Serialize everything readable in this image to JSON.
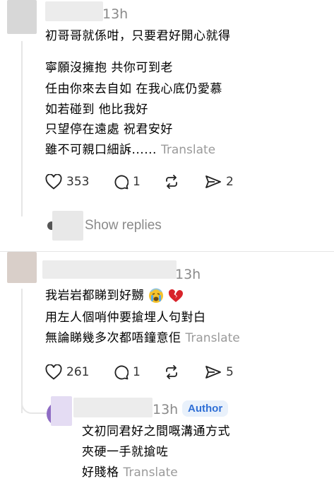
{
  "comment1": {
    "timestamp": "13h",
    "lines": [
      "初哥哥就係咁，只要君好開心就得",
      "寧願沒擁抱 共你可到老",
      "任由你來去自如 在我心底仍愛慕",
      "如若碰到 他比我好",
      "只望停在遠處 祝君安好",
      "雖不可親口細訴......"
    ],
    "translate_label": "Translate",
    "likes": "353",
    "replies": "1",
    "shares": "2",
    "show_replies_label": "Show replies"
  },
  "comment2": {
    "timestamp": "13h",
    "lines": [
      "我岩岩都睇到好嬲",
      "用左人個哨仲要搶埋人句對白",
      "無論睇幾多次都唔鐘意佢"
    ],
    "translate_label": "Translate",
    "likes": "261",
    "replies": "1",
    "shares": "5"
  },
  "reply": {
    "timestamp": "13h",
    "badge": "Author",
    "lines": [
      "文初同君好之間嘅溝通方式",
      "夾硬一手就搶咗",
      "好賤格"
    ],
    "translate_label": "Translate"
  },
  "colors": {
    "author_badge_bg": "#e9f1fb",
    "author_badge_text": "#2f6fd6",
    "muted_text": "#8a8a8a",
    "heart_red": "#d8232a"
  },
  "icons": {
    "like": "heart-icon",
    "reply": "speech-bubble-icon",
    "repost": "repost-icon",
    "share": "send-icon",
    "crying": "crying-face-emoji",
    "broken_heart": "broken-heart-emoji"
  }
}
